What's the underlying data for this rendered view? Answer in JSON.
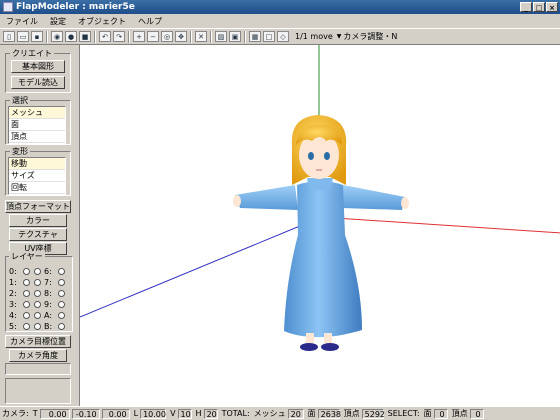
{
  "window": {
    "title": "FlapModeler : marier5e",
    "min": "_",
    "max": "□",
    "close": "×"
  },
  "menu": [
    "ファイル",
    "設定",
    "オブジェクト",
    "ヘルプ"
  ],
  "toolbar": {
    "icons": [
      "new-file-icon",
      "open-icon",
      "save-icon",
      "render-icon",
      "sphere-icon",
      "cube-icon",
      "undo-icon",
      "redo-icon",
      "zoom-in-icon",
      "zoom-out-icon",
      "zoom-fit-icon",
      "pan-icon",
      "delete-icon",
      "texture-icon",
      "camera-icon",
      "grid-icon",
      "box-icon",
      "wireframe-icon"
    ],
    "step_text": "1/1  move",
    "camera_dropdown": "カメラ調整・N"
  },
  "left": {
    "create_group": "クリエイト",
    "basic_shape_button": "基本図形",
    "model_load_button": "モデル読込",
    "select_group": "選択",
    "select_items": [
      {
        "label": "メッシュ",
        "selected": true
      },
      {
        "label": "面",
        "selected": false
      },
      {
        "label": "頂点",
        "selected": false
      }
    ],
    "transform_group": "変形",
    "transform_items": [
      {
        "label": "移動",
        "selected": true
      },
      {
        "label": "サイズ",
        "selected": false
      },
      {
        "label": "回転",
        "selected": false
      }
    ],
    "vertex_format_button": "頂点フォーマット",
    "color_button": "カラー",
    "texture_button": "テクスチャ",
    "uv_button": "UV座標",
    "layer_group": "レイヤー",
    "layers_left": [
      "0:",
      "1:",
      "2:",
      "3:",
      "4:",
      "5:"
    ],
    "layers_right": [
      "6:",
      "7:",
      "8:",
      "9:",
      "A:",
      "B:"
    ],
    "camera_target_button": "カメラ目標位置",
    "camera_angle_button": "カメラ角度"
  },
  "status": {
    "camera_label": "カメラ:",
    "t_label": "T",
    "t_value": "0.00",
    "v1": "-0.10",
    "v2": "0.00",
    "l_label": "L",
    "l_value": "10.00",
    "v_label": "V",
    "v_value": "10",
    "h_label": "H",
    "h_value": "20",
    "total_label": "TOTAL:",
    "mesh_label": "メッシュ",
    "mesh_value": "20",
    "face_label": "面",
    "face_value": "2638",
    "vertex_label": "頂点",
    "vertex_value": "5292",
    "select_label": "SELECT:",
    "sel_face_label": "面",
    "sel_face_value": "0",
    "sel_vertex_label": "頂点",
    "sel_vertex_value": "0"
  },
  "colors": {
    "x_axis": "#e03030",
    "y_axis": "#2e8b2e",
    "z_axis": "#3030c0",
    "dress": "#6fb0e8",
    "dress_light": "#9fd0f8",
    "hair": "#f0b020",
    "skin": "#fde6d4",
    "shoe": "#2a2a8a"
  }
}
